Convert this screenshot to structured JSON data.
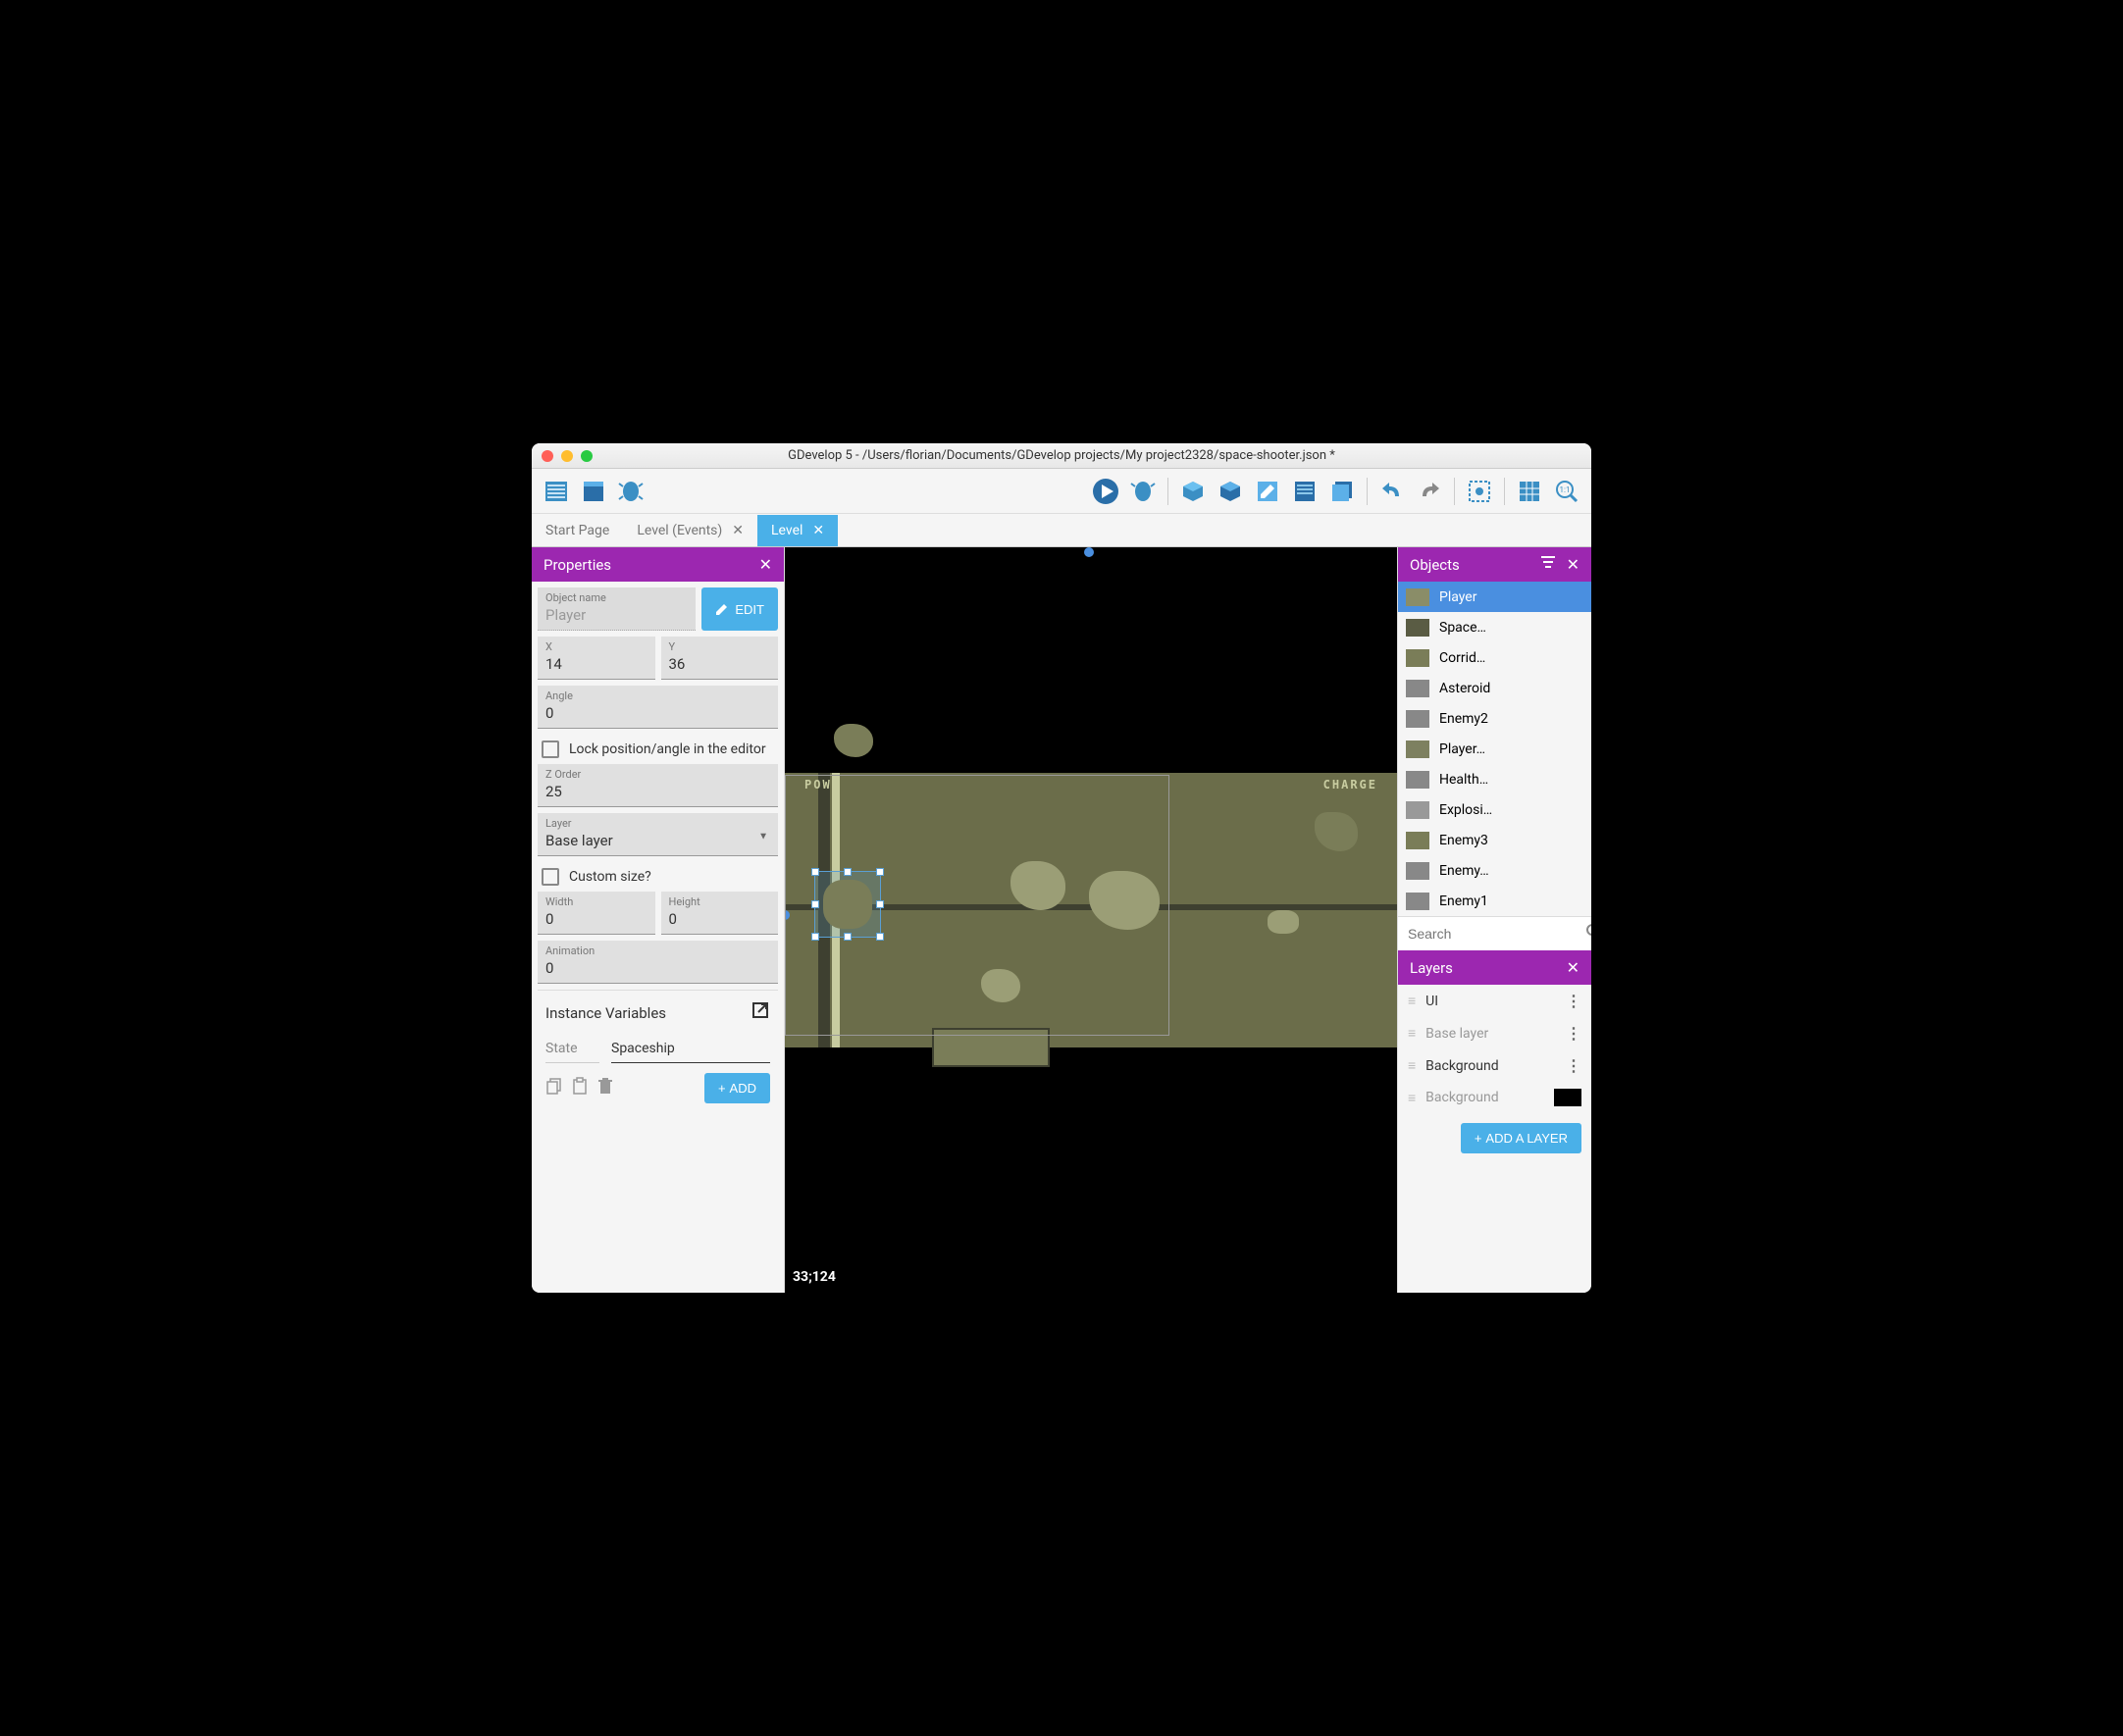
{
  "window": {
    "title": "GDevelop 5 - /Users/florian/Documents/GDevelop projects/My project2328/space-shooter.json *"
  },
  "tabs": [
    {
      "label": "Start Page",
      "closable": false,
      "active": false
    },
    {
      "label": "Level (Events)",
      "closable": true,
      "active": false
    },
    {
      "label": "Level",
      "closable": true,
      "active": true
    }
  ],
  "properties": {
    "title": "Properties",
    "object_name_label": "Object name",
    "object_name": "Player",
    "edit_label": "EDIT",
    "x_label": "X",
    "x": "14",
    "y_label": "Y",
    "y": "36",
    "angle_label": "Angle",
    "angle": "0",
    "lock_label": "Lock position/angle in the editor",
    "zorder_label": "Z Order",
    "zorder": "25",
    "layer_label": "Layer",
    "layer": "Base layer",
    "custom_size_label": "Custom size?",
    "width_label": "Width",
    "width": "0",
    "height_label": "Height",
    "height": "0",
    "animation_label": "Animation",
    "animation": "0",
    "instance_vars_label": "Instance Variables",
    "var_name": "State",
    "var_value": "Spaceship",
    "add_label": "ADD"
  },
  "canvas": {
    "coords": "33;124",
    "ui_left": "POW",
    "ui_right": "CHARGE"
  },
  "objects": {
    "title": "Objects",
    "items": [
      {
        "name": "Player",
        "selected": true
      },
      {
        "name": "Space…",
        "selected": false
      },
      {
        "name": "Corrid…",
        "selected": false
      },
      {
        "name": "Asteroid",
        "selected": false
      },
      {
        "name": "Enemy2",
        "selected": false
      },
      {
        "name": "Player…",
        "selected": false
      },
      {
        "name": "Health…",
        "selected": false
      },
      {
        "name": "Explosi…",
        "selected": false
      },
      {
        "name": "Enemy3",
        "selected": false
      },
      {
        "name": "Enemy…",
        "selected": false
      },
      {
        "name": "Enemy1",
        "selected": false
      }
    ],
    "search_placeholder": "Search"
  },
  "layers": {
    "title": "Layers",
    "items": [
      {
        "name": "UI",
        "dim": false,
        "swatch": false
      },
      {
        "name": "Base layer",
        "dim": true,
        "swatch": false
      },
      {
        "name": "Background",
        "dim": false,
        "swatch": false
      },
      {
        "name": "Background",
        "dim": true,
        "swatch": true
      }
    ],
    "add_label": "ADD A LAYER"
  }
}
